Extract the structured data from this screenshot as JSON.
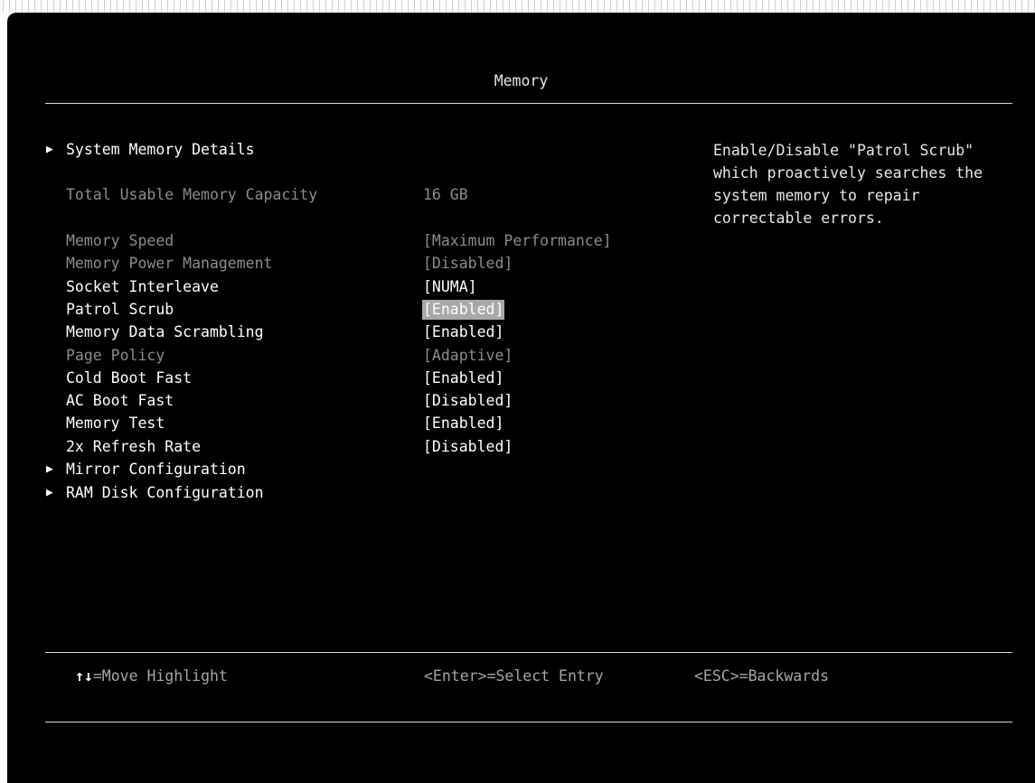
{
  "screen": {
    "title": "Memory"
  },
  "menu": [
    {
      "label": "System Memory Details",
      "arrow": "▶",
      "state": "normal"
    },
    {
      "label": "Total Usable Memory Capacity",
      "value": "16 GB",
      "state": "dim"
    },
    {
      "label": "Memory Speed",
      "value": "[Maximum Performance]",
      "state": "dim"
    },
    {
      "label": "Memory Power Management",
      "value": "[Disabled]",
      "state": "dim"
    },
    {
      "label": "Socket Interleave",
      "value": "[NUMA]",
      "state": "normal"
    },
    {
      "label": "Patrol Scrub",
      "value": "[Enabled]",
      "state": "normal",
      "highlighted": true
    },
    {
      "label": "Memory Data Scrambling",
      "value": "[Enabled]",
      "state": "normal"
    },
    {
      "label": "Page Policy",
      "value": "[Adaptive]",
      "state": "dim"
    },
    {
      "label": "Cold Boot Fast",
      "value": "[Enabled]",
      "state": "normal"
    },
    {
      "label": "AC Boot Fast",
      "value": "[Disabled]",
      "state": "normal"
    },
    {
      "label": "Memory Test",
      "value": "[Enabled]",
      "state": "normal"
    },
    {
      "label": "2x Refresh Rate",
      "value": "[Disabled]",
      "state": "normal"
    },
    {
      "label": "Mirror Configuration",
      "arrow": "▶",
      "state": "normal"
    },
    {
      "label": "RAM Disk Configuration",
      "arrow": "▶",
      "state": "normal"
    }
  ],
  "help": {
    "text": "Enable/Disable \"Patrol Scrub\" which proactively searches the system memory to repair correctable errors."
  },
  "footer": {
    "move_keys": "↑↓",
    "move": "=Move Highlight",
    "select": "<Enter>=Select Entry",
    "back": "<ESC>=Backwards"
  },
  "colors": {
    "background": "#000000",
    "text": "#ffffff",
    "disabled_text": "#8c8c8c",
    "highlight": "#a8a8a8"
  }
}
